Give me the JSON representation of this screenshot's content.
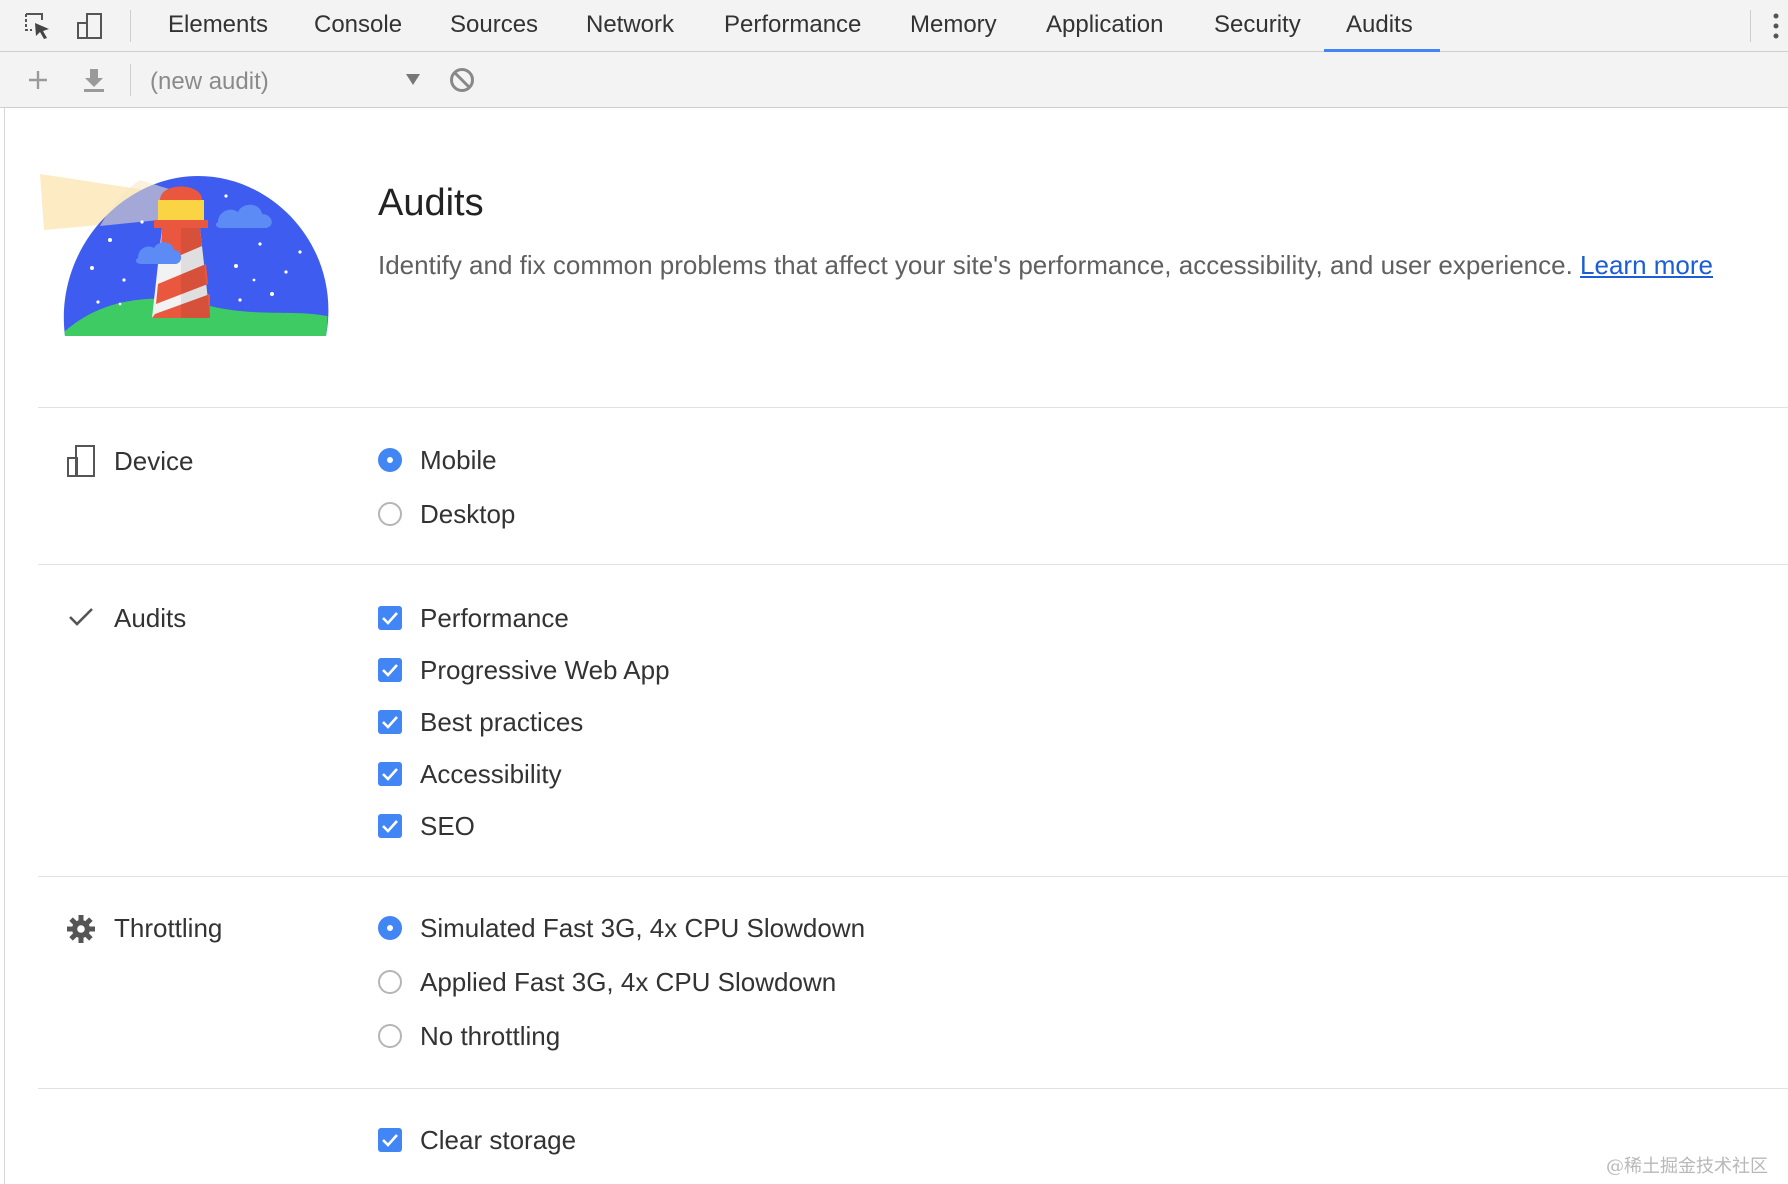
{
  "devtools": {
    "tabs": [
      {
        "label": "Elements"
      },
      {
        "label": "Console"
      },
      {
        "label": "Sources"
      },
      {
        "label": "Network"
      },
      {
        "label": "Performance"
      },
      {
        "label": "Memory"
      },
      {
        "label": "Application"
      },
      {
        "label": "Security"
      },
      {
        "label": "Audits",
        "selected": true
      }
    ],
    "accent_color": "#4285f4"
  },
  "toolbar": {
    "audit_select_value": "(new audit)"
  },
  "header": {
    "title": "Audits",
    "description": "Identify and fix common problems that affect your site's performance, accessibility, and user experience.",
    "learn_more": "Learn more"
  },
  "sections": {
    "device": {
      "label": "Device",
      "options": [
        {
          "label": "Mobile",
          "selected": true
        },
        {
          "label": "Desktop",
          "selected": false
        }
      ]
    },
    "audits": {
      "label": "Audits",
      "options": [
        {
          "label": "Performance",
          "checked": true
        },
        {
          "label": "Progressive Web App",
          "checked": true
        },
        {
          "label": "Best practices",
          "checked": true
        },
        {
          "label": "Accessibility",
          "checked": true
        },
        {
          "label": "SEO",
          "checked": true
        }
      ]
    },
    "throttling": {
      "label": "Throttling",
      "options": [
        {
          "label": "Simulated Fast 3G, 4x CPU Slowdown",
          "selected": true
        },
        {
          "label": "Applied Fast 3G, 4x CPU Slowdown",
          "selected": false
        },
        {
          "label": "No throttling",
          "selected": false
        }
      ]
    },
    "storage": {
      "options": [
        {
          "label": "Clear storage",
          "checked": true
        }
      ]
    }
  },
  "watermark": "@稀土掘金技术社区"
}
